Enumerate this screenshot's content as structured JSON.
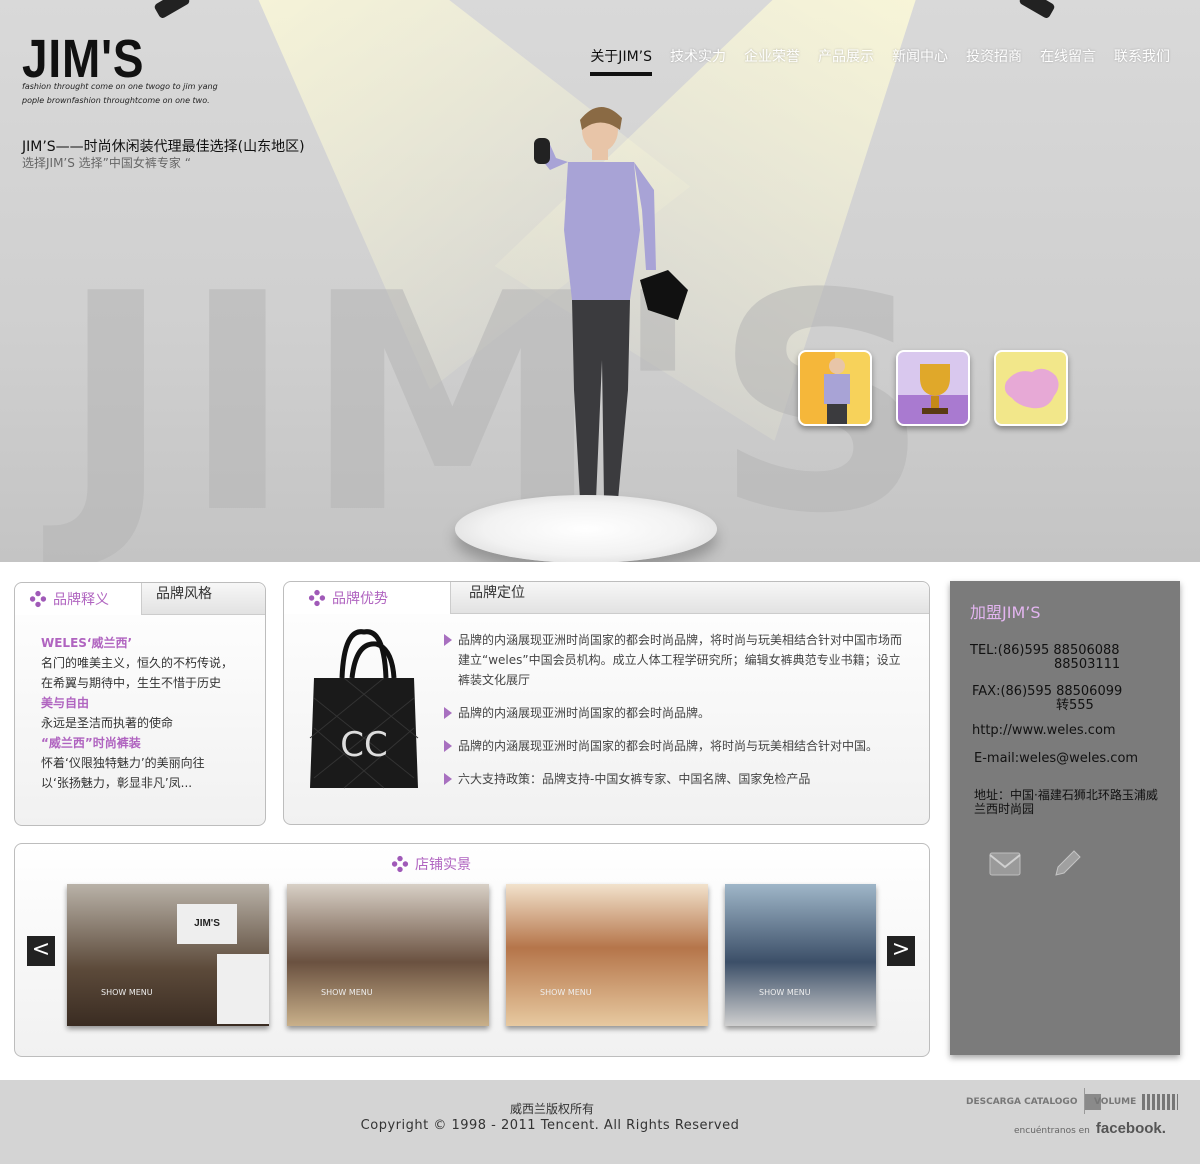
{
  "brand": {
    "logo": "JIM'S",
    "tagline": "fashion throught come on one twogo to jim yang pople brownfashion throughtcome on one two.",
    "headline": "JIM’S——时尚休闲装代理最佳选择(山东地区)",
    "subline": "选择JIM’S    选择”中国女裤专家 “"
  },
  "nav": [
    "关于JIM’S",
    "技术实力",
    "企业荣誉",
    "产品展示",
    "新闻中心",
    "投资招商",
    "在线留言",
    "联系我们"
  ],
  "hero": {
    "bgword": "JIM'S"
  },
  "brand_panel": {
    "tabs": [
      "品牌释义",
      "品牌风格"
    ],
    "lines": [
      {
        "text": "WELES‘威兰西’",
        "style": "pink"
      },
      {
        "text": "名门的唯美主义，恒久的不朽传说，",
        "style": ""
      },
      {
        "text": "在希翼与期待中，生生不惜于历史",
        "style": ""
      },
      {
        "text": "美与自由",
        "style": "pink"
      },
      {
        "text": "永远是圣洁而执著的使命",
        "style": ""
      },
      {
        "text": "“威兰西”时尚裤装",
        "style": "pink"
      },
      {
        "text": "怀着‘仪限独特魅力’的美丽向往",
        "style": ""
      },
      {
        "text": "以‘张扬魅力，彰显非凡’凤...",
        "style": ""
      }
    ]
  },
  "advantage_panel": {
    "tabs": [
      "品牌优势",
      "品牌定位"
    ],
    "bullets": [
      "品牌的内涵展现亚洲时尚国家的都会时尚品牌，将时尚与玩美相结合针对中国市场而建立“weles”中国会员机构。成立人体工程学研究所；编辑女裤典范专业书籍；设立裤装文化展厅",
      "品牌的内涵展现亚洲时尚国家的都会时尚品牌。",
      "品牌的内涵展现亚洲时尚国家的都会时尚品牌，将时尚与玩美相结合针对中国。",
      "六大支持政策：品牌支持-中国女裤专家、中国名牌、国家免检产品"
    ]
  },
  "store_panel": {
    "title": "店铺实景",
    "photos": [
      {
        "caption": "SHOW MENU",
        "sign": "JIM'S"
      },
      {
        "caption": "SHOW MENU",
        "sign": ""
      },
      {
        "caption": "SHOW MENU",
        "sign": ""
      },
      {
        "caption": "SHOW MENU",
        "sign": ""
      }
    ],
    "prev": "<",
    "next": ">"
  },
  "contact": {
    "title": "加盟JIM’S",
    "tel": "TEL:(86)595 88506088",
    "tel2": "88503111",
    "fax": "FAX:(86)595 88506099",
    "fax2": "转555",
    "web": "http://www.weles.com",
    "email": "E-mail:weles@weles.com",
    "address": "地址：中国·福建石狮北环路玉浦威兰西时尚园"
  },
  "footer": {
    "line1": "威西兰版权所有",
    "line2": "Copyright © 1998 - 2011 Tencent. All Rights Reserved",
    "catalog": "DESCARGA CATALOGO",
    "volume": "VOLUME",
    "social": "encuéntranos en",
    "facebook": "facebook."
  },
  "colors": {
    "accent": "#b064c0",
    "sidebar": "#7b7b7b",
    "footer": "#d4d4d4"
  }
}
